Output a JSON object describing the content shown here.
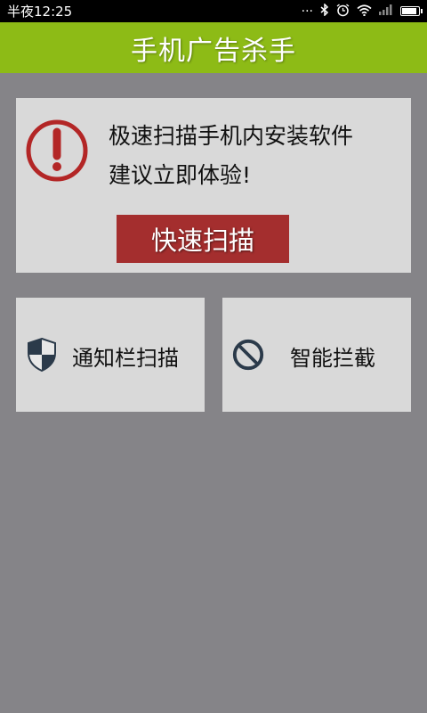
{
  "status_bar": {
    "time": "半夜12:25",
    "icons": [
      "more-dots-icon",
      "bluetooth-icon",
      "alarm-icon",
      "wifi-icon",
      "signal-icon",
      "battery-icon"
    ]
  },
  "header": {
    "title": "手机广告杀手"
  },
  "scan_card": {
    "icon": "warning-icon",
    "line1": "极速扫描手机内安装软件",
    "line2": "建议立即体验!",
    "button_label": "快速扫描"
  },
  "tiles": [
    {
      "icon": "shield-icon",
      "label": "通知栏扫描"
    },
    {
      "icon": "block-icon",
      "label": "智能拦截"
    }
  ],
  "colors": {
    "header_green": "#8dbb16",
    "button_red": "#a42e2e",
    "background": "#858488",
    "card": "#d9d9d9"
  }
}
